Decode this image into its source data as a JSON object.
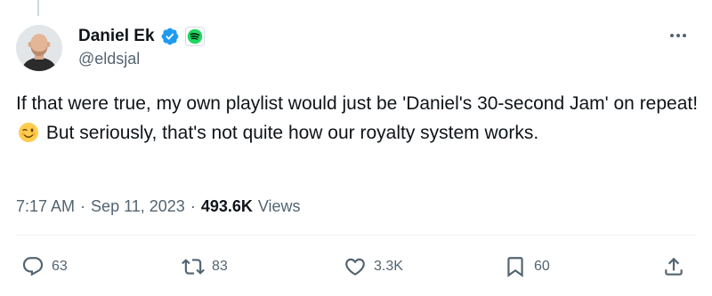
{
  "author": {
    "display_name": "Daniel Ek",
    "handle": "@eldsjal"
  },
  "tweet": {
    "text_part1": "If that were true, my own playlist would just be 'Daniel's 30-second Jam' on repeat!",
    "emoji_name": "winking-face-emoji",
    "text_part2": "But seriously, that's not quite how our royalty system works.",
    "time": "7:17 AM",
    "separator": "·",
    "date": "Sep 11, 2023",
    "views_count": "493.6K",
    "views_label": "Views"
  },
  "actions": {
    "replies": "63",
    "reposts": "83",
    "likes": "3.3K",
    "bookmarks": "60"
  },
  "icons": {
    "verified": "verified-badge-icon",
    "affiliate": "spotify-logo-icon",
    "more": "more-options-icon",
    "reply": "reply-icon",
    "repost": "repost-icon",
    "like": "like-heart-icon",
    "bookmark": "bookmark-icon",
    "share": "share-icon"
  },
  "colors": {
    "verified_blue": "#1d9bf0",
    "spotify_green": "#1ed760",
    "text_primary": "#0f1419",
    "text_secondary": "#536471"
  }
}
